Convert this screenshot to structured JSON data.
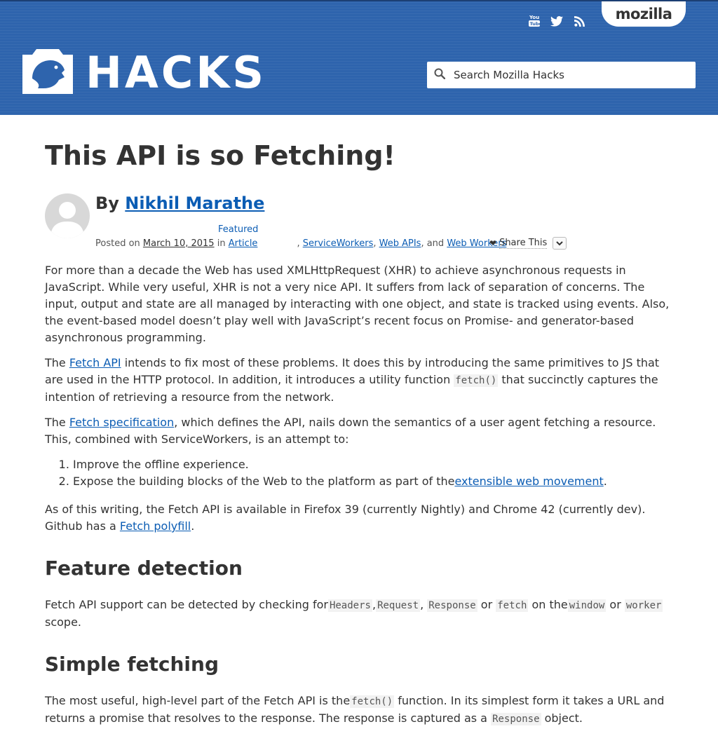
{
  "header": {
    "mozilla": "mozilla",
    "logo_text": "HACKS",
    "search_placeholder": "Search Mozilla Hacks",
    "social": [
      "youtube-icon",
      "twitter-icon",
      "rss-icon"
    ]
  },
  "article": {
    "title": "This API is so Fetching!",
    "by": "By",
    "author": "Nikhil Marathe",
    "posted_on": "Posted on",
    "date": "March 10, 2015",
    "in": "in",
    "category1_top": "Featured",
    "category1": "Article",
    "comma1": ",",
    "category2": "ServiceWorkers",
    "comma2": ",",
    "category3": "Web APIs",
    "and": ", and",
    "category4": "Web Workers",
    "share": "Share This",
    "p1": "For more than a decade the Web has used XMLHttpRequest (XHR) to achieve asynchronous requests in JavaScript. While very useful, XHR is not a very nice API. It suffers from lack of separation of concerns. The input, output and state are all managed by interacting with one object, and state is tracked using events. Also, the event-based model doesn’t play well with JavaScript’s recent focus on Promise- and generator-based asynchronous programming.",
    "p2_a": "The ",
    "p2_link": "Fetch API",
    "p2_b": " intends to fix most of these problems. It does this by introducing the same primitives to JS that are used in the HTTP protocol. In addition, it introduces a utility function ",
    "p2_code": "fetch()",
    "p2_c": " that succinctly captures the intention of retrieving a resource from the network.",
    "p3_a": "The ",
    "p3_link": "Fetch specification",
    "p3_b": ", which defines the API, nails down the semantics of a user agent fetching a resource. This, combined with ServiceWorkers, is an attempt to:",
    "li1": "Improve the offline experience.",
    "li2_a": "Expose the building blocks of the Web to the platform as part of the",
    "li2_link": "extensible web movement",
    "li2_b": ".",
    "p4_a": "As of this writing, the Fetch API is available in Firefox 39 (currently Nightly) and Chrome 42 (currently dev). Github has a ",
    "p4_link": "Fetch polyfill",
    "p4_b": ".",
    "h2_1": "Feature detection",
    "p5_a": "Fetch API support can be detected by checking for",
    "p5_code1": "Headers",
    "p5_comma1": ",",
    "p5_code2": "Request",
    "p5_comma2": ", ",
    "p5_code3": "Response",
    "p5_or1": " or ",
    "p5_code4": "fetch",
    "p5_on": " on the",
    "p5_code5": "window",
    "p5_or2": " or ",
    "p5_code6": "worker",
    "p5_end": " scope.",
    "h2_2": "Simple fetching",
    "p6_a": "The most useful, high-level part of the Fetch API is the",
    "p6_code1": "fetch()",
    "p6_b": " function. In its simplest form it takes a URL and returns a promise that resolves to the response. The response is captured as a ",
    "p6_code2": "Response",
    "p6_c": " object."
  }
}
